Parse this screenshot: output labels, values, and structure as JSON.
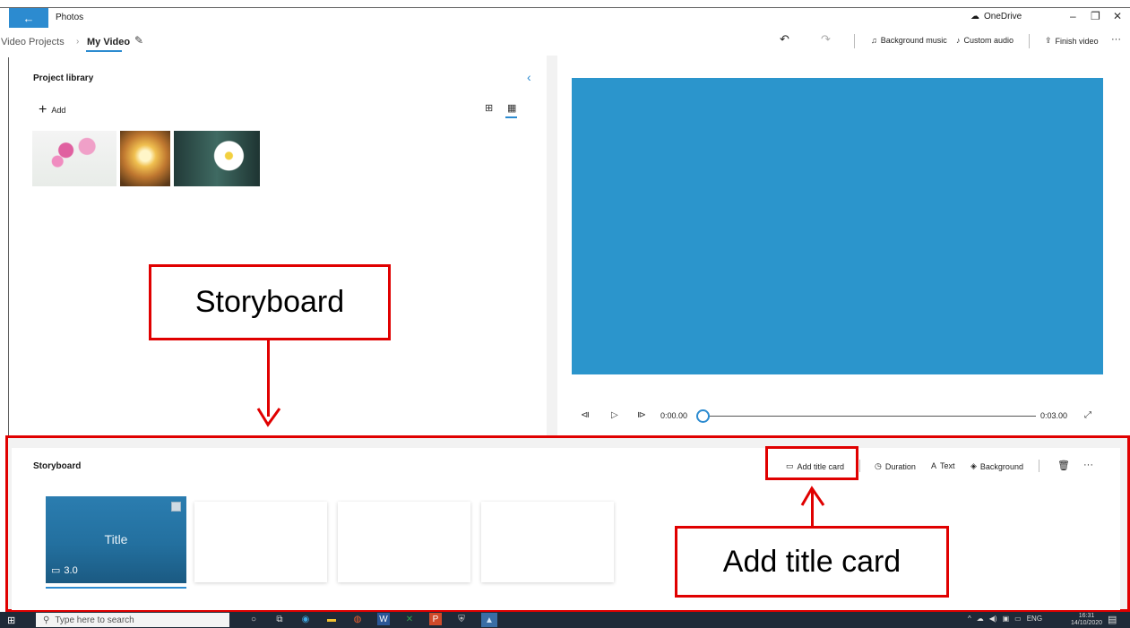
{
  "titlebar": {
    "app_title": "Photos",
    "onedrive_label": "OneDrive",
    "minimize": "–",
    "maximize": "❐",
    "close": "✕"
  },
  "navbar": {
    "crumb_root": "Video Projects",
    "crumb_current": "My Video",
    "undo_icon": "↶",
    "redo_icon": "↷",
    "background_music": "Background music",
    "custom_audio": "Custom audio",
    "finish_video": "Finish video",
    "more": "···"
  },
  "library": {
    "title": "Project library",
    "add_label": "Add",
    "collapse_icon": "‹",
    "thumbnails": [
      "pink-cosmos-flowers",
      "dandelion-backlit",
      "white-daisy"
    ]
  },
  "player": {
    "current_time": "0:00.00",
    "total_time": "0:03.00",
    "progress": 0.0
  },
  "storyboard": {
    "title": "Storyboard",
    "add_title_card": "Add title card",
    "duration": "Duration",
    "text": "Text",
    "background": "Background",
    "more": "···",
    "title_card": {
      "text": "Title",
      "duration": "3.0"
    },
    "empty_slots": 3
  },
  "annotations": {
    "storyboard_label": "Storyboard",
    "add_title_card_label": "Add title card",
    "color": "#e00000"
  },
  "taskbar": {
    "search_placeholder": "Type here to search",
    "language": "ENG",
    "time": "16:31",
    "date": "14/10/2020"
  },
  "colors": {
    "accent": "#2c8bd0",
    "preview": "#2b95cc",
    "taskbar": "#1f2a38"
  }
}
